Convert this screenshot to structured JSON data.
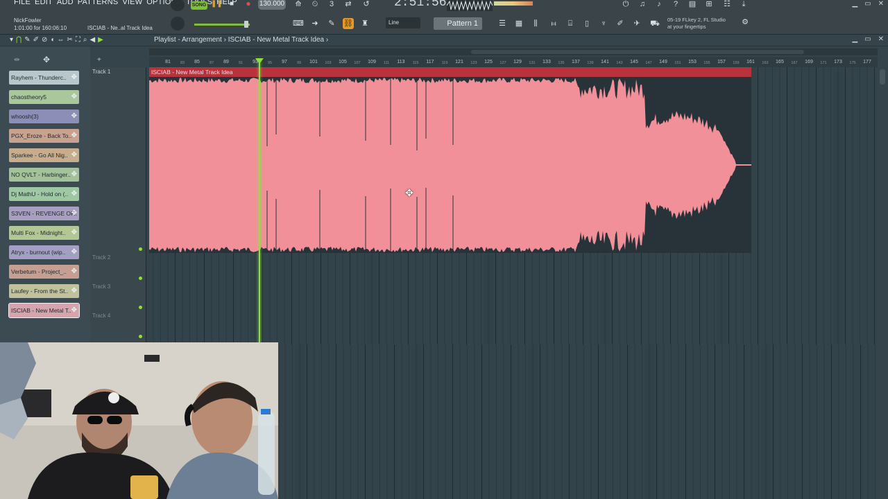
{
  "menu": [
    "FILE",
    "EDIT",
    "ADD",
    "PATTERNS",
    "VIEW",
    "OPTIONS",
    "TOOLS",
    "HELP"
  ],
  "hint": {
    "user": "NickFowler",
    "time": "1:01:00 for 160:06:10",
    "project": "ISCIAB - Ne..al Track Idea"
  },
  "transport": {
    "mode": "SONG",
    "tempo": "130.000",
    "clock": "2:51:56"
  },
  "toolbar": {
    "snap": "Line",
    "pattern": "Pattern 1",
    "hint_line1": "05-19  FLkey 2, FL Studio",
    "hint_line2": "at your fingertips"
  },
  "playlist": {
    "title": "Playlist - Arrangement › ISCIAB - New Metal Track Idea ›"
  },
  "ruler": {
    "labels": [
      "81",
      "83",
      "85",
      "87",
      "89",
      "91",
      "93",
      "95",
      "97",
      "99",
      "101",
      "103",
      "105",
      "107",
      "109",
      "111",
      "113",
      "115",
      "117",
      "119",
      "121",
      "123",
      "125",
      "127",
      "129",
      "131",
      "133",
      "135",
      "137",
      "139",
      "141",
      "143",
      "145",
      "147",
      "149",
      "151",
      "153",
      "155",
      "157",
      "159",
      "161",
      "163",
      "165",
      "167",
      "169",
      "171",
      "173",
      "175",
      "177"
    ]
  },
  "patterns": [
    {
      "label": "Rayhem - Thunderc..",
      "color": "#b8c7cc"
    },
    {
      "label": "chaostheory5",
      "color": "#a9c79a"
    },
    {
      "label": "whoosh(3)",
      "color": "#8d8eb8"
    },
    {
      "label": "PGX_Eroze - Back To..",
      "color": "#c9a28f"
    },
    {
      "label": "Sparkee - Go All Nig..",
      "color": "#c7ad8c"
    },
    {
      "label": "NO QVLT - Harbinger..",
      "color": "#a3c29a"
    },
    {
      "label": "Dj MathU - Hold on (..",
      "color": "#9ec7a4"
    },
    {
      "label": "S3VEN - REVENGE OF..",
      "color": "#a79fc0"
    },
    {
      "label": "Multi Fox - Midnight..",
      "color": "#b3c794"
    },
    {
      "label": "Atryx - burnout (wip..",
      "color": "#a29ec4"
    },
    {
      "label": "Verbetum - Project_..",
      "color": "#c69e92"
    },
    {
      "label": "Laufey - From the St..",
      "color": "#bfc29a"
    },
    {
      "label": "ISCIAB - New Metal T..",
      "color": "#d6a4ac"
    }
  ],
  "tracks": [
    "Track 1",
    "Track 2",
    "Track 3",
    "Track 4"
  ],
  "clip": {
    "name": "ISCIAB - New Metal Track Idea",
    "color": "#f2909a"
  }
}
